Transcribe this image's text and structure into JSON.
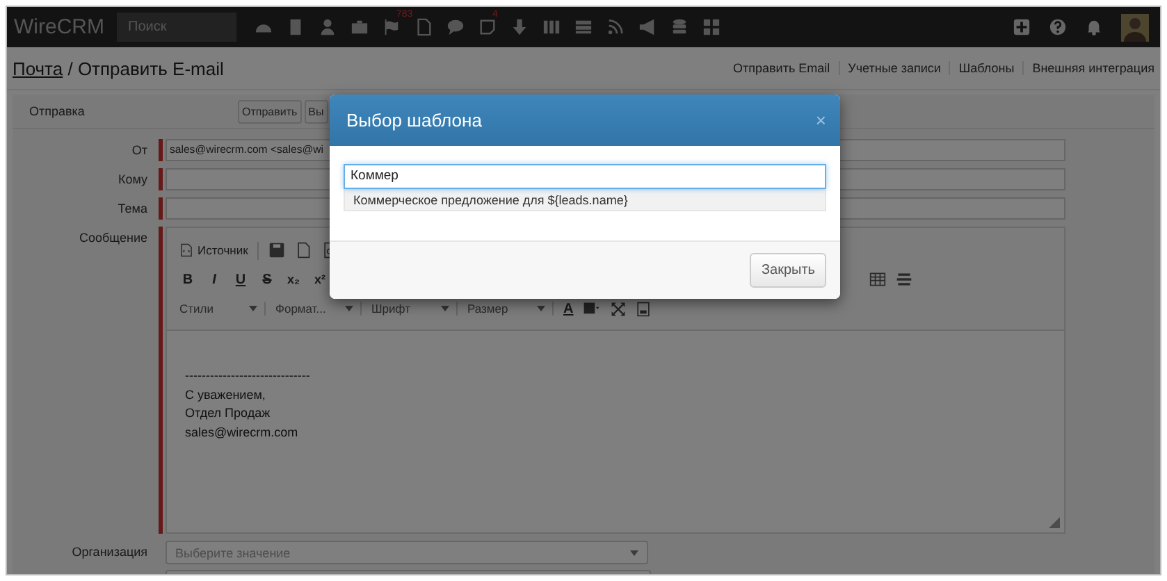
{
  "topbar": {
    "logo": "WireCRM",
    "search": {
      "placeholder": "Поиск"
    },
    "icons": [
      {
        "kind": "dashboard"
      },
      {
        "kind": "building"
      },
      {
        "kind": "person"
      },
      {
        "kind": "briefcase"
      },
      {
        "kind": "flag",
        "badge": "783"
      },
      {
        "kind": "file"
      },
      {
        "kind": "comment"
      },
      {
        "kind": "note",
        "badge": "4"
      },
      {
        "kind": "download"
      },
      {
        "kind": "columns"
      },
      {
        "kind": "list"
      },
      {
        "kind": "rss"
      },
      {
        "kind": "bullhorn"
      },
      {
        "kind": "database"
      },
      {
        "kind": "grid"
      }
    ],
    "right_icons": [
      {
        "kind": "plus"
      },
      {
        "kind": "question"
      },
      {
        "kind": "bell"
      },
      {
        "kind": "avatar"
      }
    ]
  },
  "breadcrumb": {
    "link": "Почта",
    "current": "/ Отправить E-mail"
  },
  "nav_links": [
    "Отправить Email",
    "Учетные записи",
    "Шаблоны",
    "Внешняя интеграция"
  ],
  "toolbar": {
    "label": "Отправка",
    "buttons": [
      "Отправить",
      "Вы"
    ]
  },
  "fields": [
    {
      "label": "От",
      "value": "sales@wirecrm.com <sales@wi"
    },
    {
      "label": "Кому"
    },
    {
      "label": "Тема"
    }
  ],
  "editor": {
    "label": "Сообщение",
    "row1": [
      {
        "kind": "source",
        "text": "Источник"
      },
      {
        "kind": "save"
      },
      {
        "kind": "newpage"
      },
      {
        "kind": "preview"
      }
    ],
    "row2": [
      {
        "kind": "bold",
        "text": "B"
      },
      {
        "kind": "italic",
        "text": "I"
      },
      {
        "kind": "underline",
        "text": "U"
      },
      {
        "kind": "strike",
        "text": "S"
      },
      {
        "kind": "sub",
        "text": "x₂"
      },
      {
        "kind": "sup",
        "text": "x²"
      },
      {
        "kind": "table"
      },
      {
        "kind": "hr"
      }
    ],
    "row3": [
      {
        "kind": "combo",
        "text": "Стили"
      },
      {
        "kind": "combo",
        "text": "Формат..."
      },
      {
        "kind": "combo",
        "text": "Шрифт"
      },
      {
        "kind": "combo",
        "text": "Размер"
      },
      {
        "kind": "textcolor",
        "text": "A"
      },
      {
        "kind": "bgcolor"
      },
      {
        "kind": "maximize"
      },
      {
        "kind": "blocks"
      }
    ],
    "body_lines": [
      "------------------------------",
      "С уважением,",
      "Отдел Продаж",
      "sales@wirecrm.com"
    ]
  },
  "organization": {
    "label": "Организация",
    "placeholder": "Выберите значение"
  },
  "modal": {
    "title": "Выбор шаблона",
    "close": "×",
    "search_value": "Коммер",
    "suggestions": [
      "Коммерческое предложение для ${leads.name}"
    ],
    "buttons": [
      "Закрыть"
    ]
  }
}
